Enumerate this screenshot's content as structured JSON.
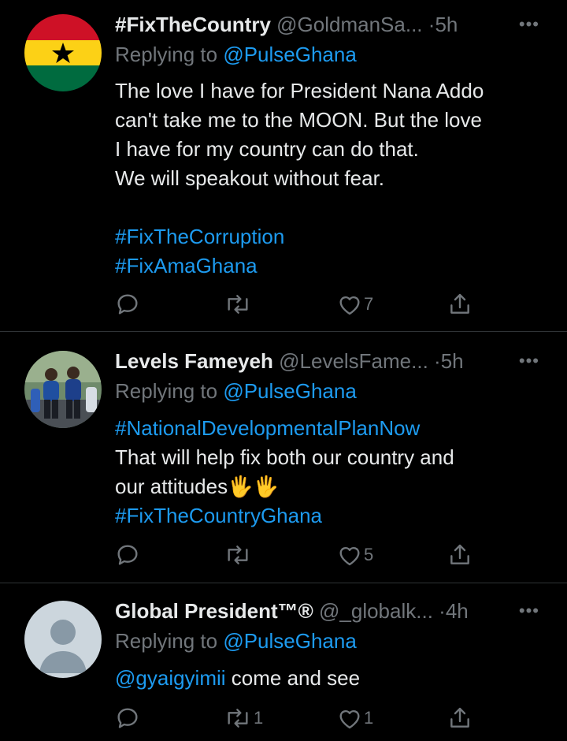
{
  "tweets": [
    {
      "display_name": "#FixTheCountry",
      "handle": "@GoldmanSa...",
      "time": "5h",
      "more": "•••",
      "replying_prefix": "Replying to ",
      "replying_to": "@PulseGhana",
      "lines": [
        "The love I have for President Nana Addo",
        "can't take me to the MOON. But the love",
        "I have for my country can do that.",
        "We will speakout without fear."
      ],
      "hashtags": [
        "#FixTheCorruption",
        "#FixAmaGhana"
      ],
      "likes": "7",
      "retweets": "",
      "avatar": "ghana-flag"
    },
    {
      "display_name": "Levels Fameyeh",
      "handle": "@LevelsFame...",
      "time": "5h",
      "more": "•••",
      "replying_prefix": "Replying to ",
      "replying_to": "@PulseGhana",
      "hashtag_top": "#NationalDevelopmentalPlanNow",
      "line_1": "That will help fix both our country and",
      "line_2": "our attitudes",
      "emoji": "🖐🖐",
      "hashtag_bottom": "#FixTheCountryGhana",
      "likes": "5",
      "retweets": "",
      "avatar": "group-photo"
    },
    {
      "display_name": "Global President™®",
      "handle": "@_globalk...",
      "time": "4h",
      "more": "•••",
      "replying_prefix": "Replying to ",
      "replying_to": "@PulseGhana",
      "mention": "@gyaigyimii",
      "text": " come and see",
      "likes": "1",
      "retweets": "1",
      "avatar": "default-avatar"
    }
  ],
  "colors": {
    "background": "#000000",
    "text": "#e7e9ea",
    "muted": "#71767b",
    "accent": "#1d9bf0",
    "divider": "#2f3336"
  },
  "icons": [
    "reply-icon",
    "retweet-icon",
    "like-icon",
    "share-icon",
    "more-icon"
  ]
}
